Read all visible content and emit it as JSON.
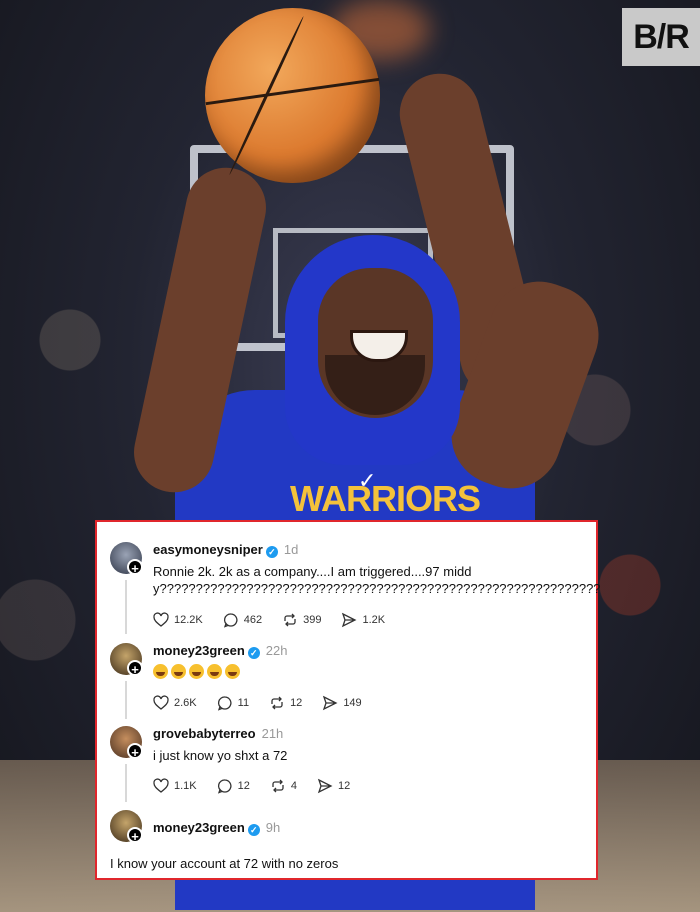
{
  "watermark": "B/R",
  "jersey_text": "WARRIORS",
  "posts": [
    {
      "username": "easymoneysniper",
      "time": "1d",
      "text": "Ronnie 2k. 2k as a company....I am triggered....97 middy?????????????????????????????????????????????????????????????",
      "likes": "12.2K",
      "replies": "462",
      "reposts": "399",
      "shares": "1.2K"
    },
    {
      "username": "money23green",
      "time": "22h",
      "emoji_count": 5,
      "likes": "2.6K",
      "replies": "11",
      "reposts": "12",
      "shares": "149"
    },
    {
      "username": "grovebabyterreo",
      "time": "21h",
      "text": "i just know yo shxt a 72",
      "likes": "1.1K",
      "replies": "12",
      "reposts": "4",
      "shares": "12"
    },
    {
      "username": "money23green",
      "time": "9h",
      "text": "I know your account at 72 with no zeros"
    }
  ],
  "colors": {
    "card_border": "#e0262c",
    "verified": "#1d9bf0",
    "jersey": "#2239c4"
  },
  "icons": [
    "heart-icon",
    "comment-icon",
    "repost-icon",
    "share-icon",
    "verified-icon",
    "plus-icon"
  ]
}
